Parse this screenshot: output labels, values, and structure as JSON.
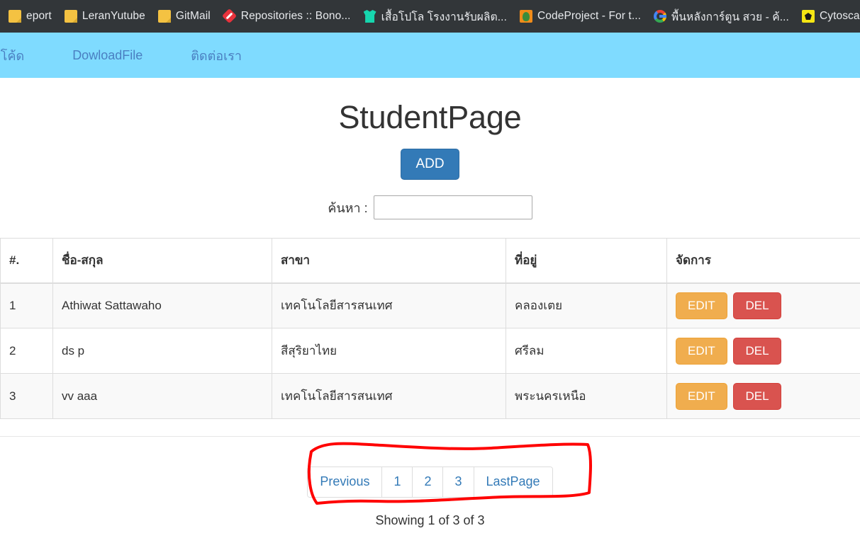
{
  "browser": {
    "bookmarks": [
      {
        "label": "eport",
        "icon": "folder-icon"
      },
      {
        "label": "LeranYutube",
        "icon": "folder-icon"
      },
      {
        "label": "GitMail",
        "icon": "folder-icon"
      },
      {
        "label": "Repositories :: Bono...",
        "icon": "bonobo-diamond-icon"
      },
      {
        "label": "เสื้อโปโล โรงงานรับผลิต...",
        "icon": "shirt-icon"
      },
      {
        "label": "CodeProject - For t...",
        "icon": "codeproject-icon"
      },
      {
        "label": "พื้นหลังการ์ตูน สวย - ค้...",
        "icon": "google-icon"
      },
      {
        "label": "Cytoscape.js",
        "icon": "cytoscape-icon"
      }
    ],
    "overflow_icon": "app-tile-icon"
  },
  "navbar": {
    "background": "#7fdbff",
    "link_color": "#4a7fc1",
    "links": [
      {
        "label": "าร์โค้ด"
      },
      {
        "label": "DowloadFile"
      },
      {
        "label": "ติดต่อเรา"
      }
    ]
  },
  "main": {
    "title": "StudentPage",
    "add_button": "ADD",
    "add_button_color": "#337ab7",
    "search": {
      "label": "ค้นหา :",
      "value": "",
      "placeholder": ""
    },
    "table": {
      "headers": [
        "#.",
        "ชื่อ-สกุล",
        "สาขา",
        "ที่อยู่",
        "จัดการ"
      ],
      "rows": [
        {
          "index": "1",
          "name": "Athiwat Sattawaho",
          "branch": "เทคโนโลยีสารสนเทศ",
          "address": "คลองเตย",
          "edit": "EDIT",
          "del": "DEL"
        },
        {
          "index": "2",
          "name": "ds p",
          "branch": "สีสุริยาไทย",
          "address": "ศรีลม",
          "edit": "EDIT",
          "del": "DEL"
        },
        {
          "index": "3",
          "name": "vv aaa",
          "branch": "เทคโนโลยีสารสนเทศ",
          "address": "พระนครเหนือ",
          "edit": "EDIT",
          "del": "DEL"
        }
      ],
      "edit_color": "#f0ad4e",
      "del_color": "#d9534f"
    },
    "pagination": {
      "previous": "Previous",
      "pages": [
        "1",
        "2",
        "3"
      ],
      "last": "LastPage",
      "link_color": "#337ab7"
    },
    "showing_text": "Showing 1 of 3 of 3"
  },
  "annotation": {
    "color": "#ff0000",
    "shape": "hand-drawn-rectangle"
  }
}
